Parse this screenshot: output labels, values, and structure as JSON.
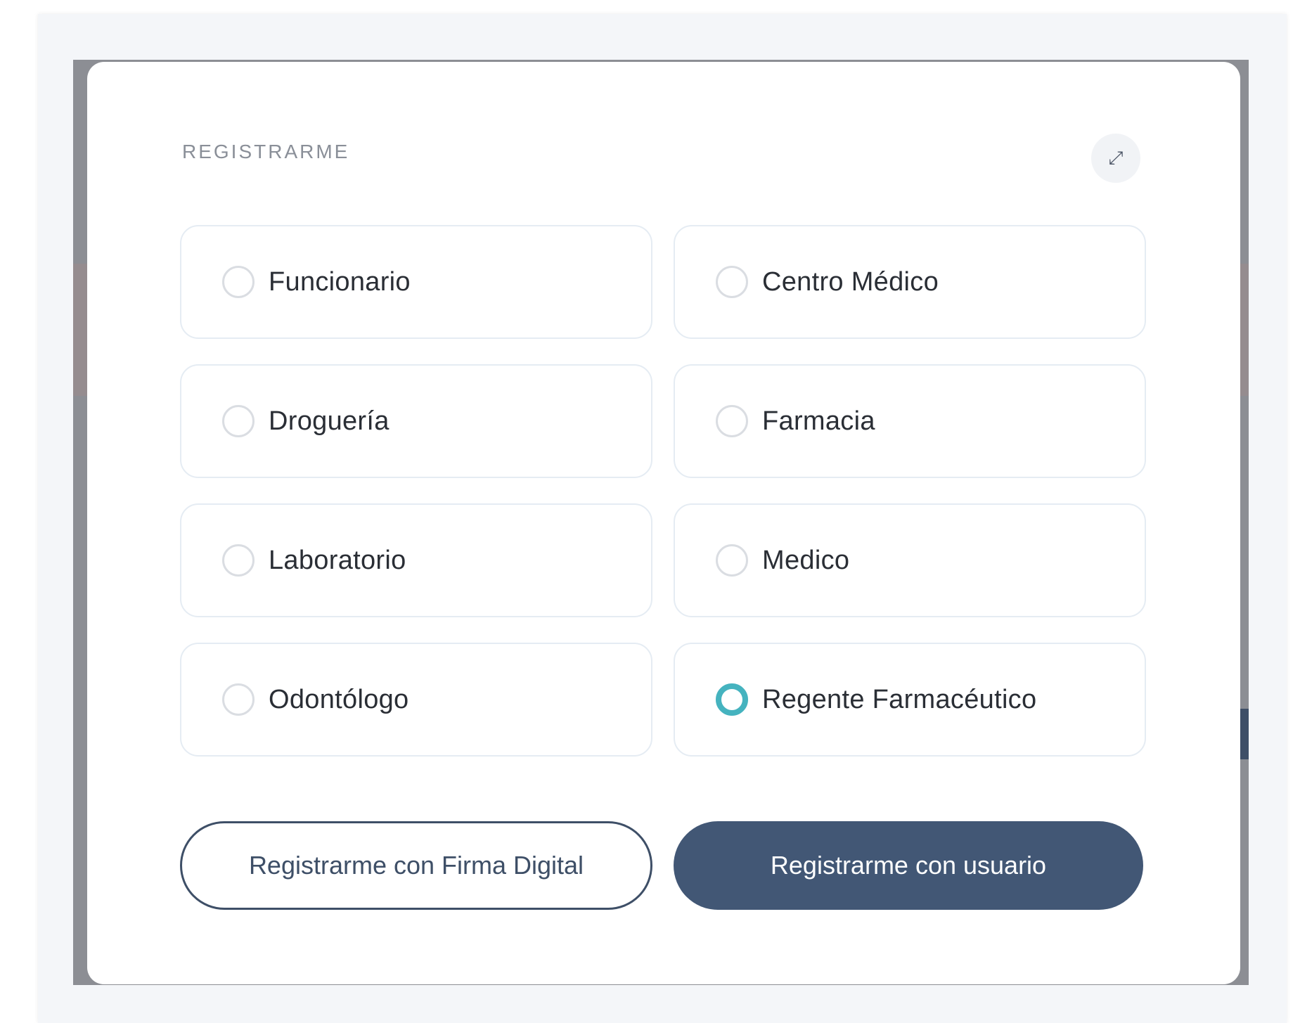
{
  "modal": {
    "title": "REGISTRARME",
    "close_icon": "close-icon",
    "close_glyph": "⤢"
  },
  "options": [
    {
      "label": "Funcionario",
      "selected": false
    },
    {
      "label": "Centro Médico",
      "selected": false
    },
    {
      "label": "Droguería",
      "selected": false
    },
    {
      "label": "Farmacia",
      "selected": false
    },
    {
      "label": "Laboratorio",
      "selected": false
    },
    {
      "label": "Medico",
      "selected": false
    },
    {
      "label": "Odontólogo",
      "selected": false
    },
    {
      "label": "Regente Farmacéutico",
      "selected": true
    }
  ],
  "actions": {
    "digital_signature_label": "Registrarme con Firma Digital",
    "user_label": "Registrarme con usuario"
  },
  "colors": {
    "accent": "#45b3bf",
    "primary": "#425775"
  }
}
